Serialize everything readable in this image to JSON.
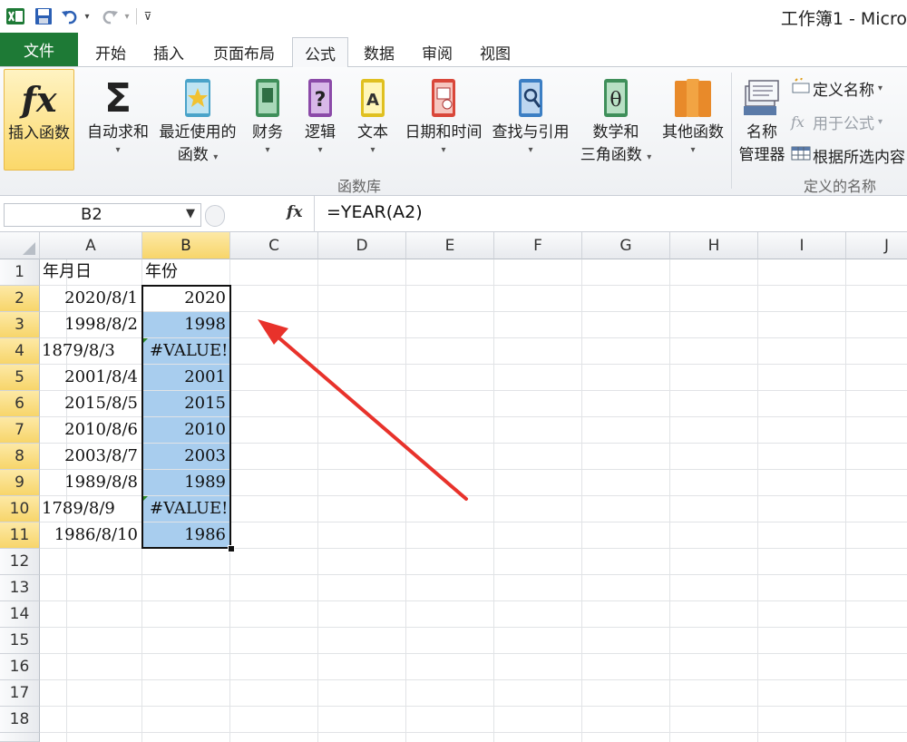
{
  "title_bar": {
    "app_title": "工作簿1 - Micro"
  },
  "tabs": [
    {
      "label": "文件",
      "type": "file"
    },
    {
      "label": "开始"
    },
    {
      "label": "插入"
    },
    {
      "label": "页面布局"
    },
    {
      "label": "公式",
      "active": true
    },
    {
      "label": "数据"
    },
    {
      "label": "审阅"
    },
    {
      "label": "视图"
    }
  ],
  "ribbon": {
    "insert_function": "插入函数",
    "autosum": "自动求和",
    "recent_line1": "最近使用的",
    "recent_line2": "函数",
    "financial": "财务",
    "logical": "逻辑",
    "text": "文本",
    "datetime": "日期和时间",
    "lookup": "查找与引用",
    "math_line1": "数学和",
    "math_line2": "三角函数",
    "more": "其他函数",
    "function_library": "函数库",
    "name_mgr_line1": "名称",
    "name_mgr_line2": "管理器",
    "define_name": "定义名称",
    "use_in_formula": "用于公式",
    "create_from_selection": "根据所选内容",
    "defined_names": "定义的名称",
    "fx_symbol": "fx",
    "sigma": "Σ",
    "theta": "θ",
    "question": "?",
    "letter_a": "A"
  },
  "formula_bar": {
    "name_box": "B2",
    "fx_label": "fx",
    "formula": "=YEAR(A2)"
  },
  "sheet": {
    "columns": [
      "A",
      "B",
      "C",
      "D",
      "E",
      "F",
      "G",
      "H",
      "I",
      "J"
    ],
    "rows": [
      "1",
      "2",
      "3",
      "4",
      "5",
      "6",
      "7",
      "8",
      "9",
      "10",
      "11",
      "12",
      "13",
      "14",
      "15",
      "16",
      "17",
      "18"
    ],
    "header_a": "年月日",
    "header_b": "年份",
    "data": [
      {
        "a": "2020/8/1",
        "b": "2020"
      },
      {
        "a": "1998/8/2",
        "b": "1998"
      },
      {
        "a": "1879/8/3",
        "b": "#VALUE!"
      },
      {
        "a": "2001/8/4",
        "b": "2001"
      },
      {
        "a": "2015/8/5",
        "b": "2015"
      },
      {
        "a": "2010/8/6",
        "b": "2010"
      },
      {
        "a": "2003/8/7",
        "b": "2003"
      },
      {
        "a": "1989/8/8",
        "b": "1989"
      },
      {
        "a": "1789/8/9",
        "b": "#VALUE!"
      },
      {
        "a": "1986/8/10",
        "b": "1986"
      }
    ]
  },
  "colors": {
    "file_tab": "#1e7a36",
    "selection_fill": "#a8cdee",
    "header_highlight": "#f7d56a",
    "arrow": "#e8322b"
  }
}
